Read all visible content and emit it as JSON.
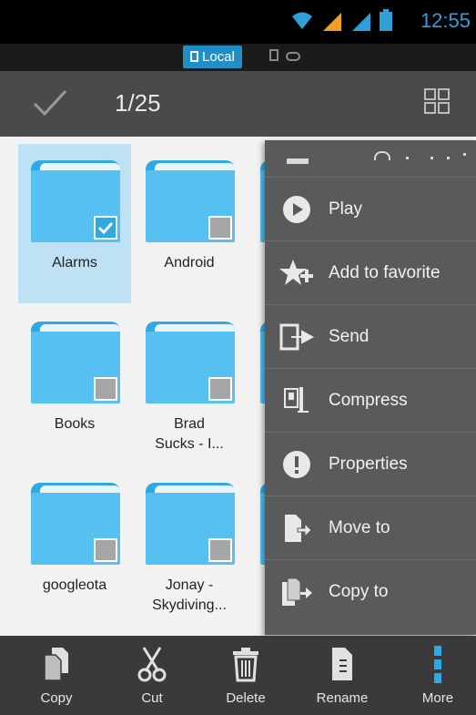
{
  "status_bar": {
    "time": "12:55"
  },
  "location_bar": {
    "active_tab": "Local"
  },
  "action_bar": {
    "selection_count": "1/25"
  },
  "files": [
    {
      "name": "Alarms",
      "selected": true
    },
    {
      "name": "Android",
      "selected": false
    },
    {
      "name": "Books",
      "selected": false
    },
    {
      "name": "Brad Sucks - I...",
      "selected": false
    },
    {
      "name": "googleota",
      "selected": false
    },
    {
      "name": "Jonay - Skydiving...",
      "selected": false
    }
  ],
  "context_menu": {
    "items": [
      {
        "label": "Play",
        "icon": "play-icon"
      },
      {
        "label": "Add to favorite",
        "icon": "star-add-icon"
      },
      {
        "label": "Send",
        "icon": "send-icon"
      },
      {
        "label": "Compress",
        "icon": "compress-icon"
      },
      {
        "label": "Properties",
        "icon": "info-icon"
      },
      {
        "label": "Move to",
        "icon": "move-icon"
      },
      {
        "label": "Copy to",
        "icon": "copy-to-icon"
      }
    ]
  },
  "bottom_bar": {
    "items": [
      {
        "label": "Copy",
        "icon": "copy-icon"
      },
      {
        "label": "Cut",
        "icon": "scissors-icon"
      },
      {
        "label": "Delete",
        "icon": "trash-icon"
      },
      {
        "label": "Rename",
        "icon": "rename-icon"
      },
      {
        "label": "More",
        "icon": "more-vertical-icon"
      }
    ]
  },
  "colors": {
    "accent": "#2ea9e1",
    "folder": "#56c1f0",
    "selected_tile": "#bfe1f4",
    "menu_bg": "#5a5a5a"
  }
}
